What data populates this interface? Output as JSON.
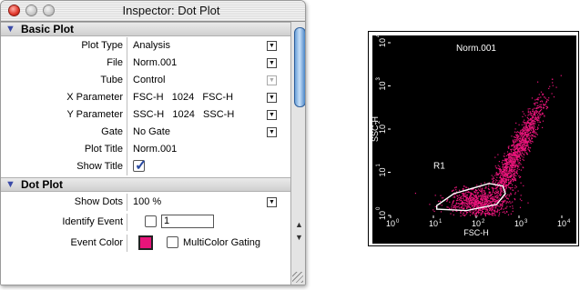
{
  "window": {
    "title": "Inspector: Dot Plot",
    "traffic": {
      "close": "close-button",
      "minimize": "minimize-button",
      "zoom": "zoom-button"
    }
  },
  "sections": {
    "basic_plot": "Basic Plot",
    "dot_plot": "Dot Plot"
  },
  "rows": {
    "plot_type": {
      "label": "Plot Type",
      "value": "Analysis"
    },
    "file": {
      "label": "File",
      "value": "Norm.001"
    },
    "tube": {
      "label": "Tube",
      "value": "Control"
    },
    "x_param": {
      "label": "X Parameter",
      "value": "FSC-H   1024   FSC-H"
    },
    "y_param": {
      "label": "Y Parameter",
      "value": "SSC-H   1024   SSC-H"
    },
    "gate": {
      "label": "Gate",
      "value": "No Gate"
    },
    "plot_title": {
      "label": "Plot Title",
      "value": "Norm.001"
    },
    "show_title": {
      "label": "Show Title",
      "checked": true
    },
    "show_dots": {
      "label": "Show Dots",
      "value": "100 %"
    },
    "identify_event": {
      "label": "Identify Event",
      "value": "1",
      "checked": false
    },
    "event_color": {
      "label": "Event Color",
      "color": "#e8147a",
      "multicolor_label": "MultiColor Gating",
      "multicolor_checked": false
    }
  },
  "colors": {
    "accent": "#3a4aa8",
    "event": "#e8147a"
  },
  "chart_data": {
    "type": "scatter",
    "title": "Norm.001",
    "xlabel": "FSC-H",
    "ylabel": "SSC-H",
    "x_scale": "log",
    "y_scale": "log",
    "xlim": [
      1,
      10000
    ],
    "ylim": [
      1,
      10000
    ],
    "x_ticks": [
      "10^0",
      "10^1",
      "10^2",
      "10^3",
      "10^4"
    ],
    "y_ticks": [
      "10^0",
      "10^1",
      "10^2",
      "10^3",
      "10^4"
    ],
    "region_label": "R1",
    "point_color": "#e8147a",
    "background": "#000000",
    "clusters": [
      {
        "center_x": 110,
        "center_y": 2.0,
        "spread_x": 0.35,
        "spread_y": 0.18,
        "count": 900
      },
      {
        "center_x": 1000,
        "center_y": 40,
        "spread_x": 0.1,
        "spread_y": 0.55,
        "count": 1100
      },
      {
        "center_x": 500,
        "center_y": 8,
        "spread_x": 0.15,
        "spread_y": 0.2,
        "count": 200
      }
    ],
    "gate_region_R1": [
      [
        12,
        1.7
      ],
      [
        30,
        3.2
      ],
      [
        200,
        5.5
      ],
      [
        420,
        4.8
      ],
      [
        480,
        3.2
      ],
      [
        300,
        1.8
      ],
      [
        60,
        1.3
      ],
      [
        12,
        1.4
      ]
    ]
  }
}
